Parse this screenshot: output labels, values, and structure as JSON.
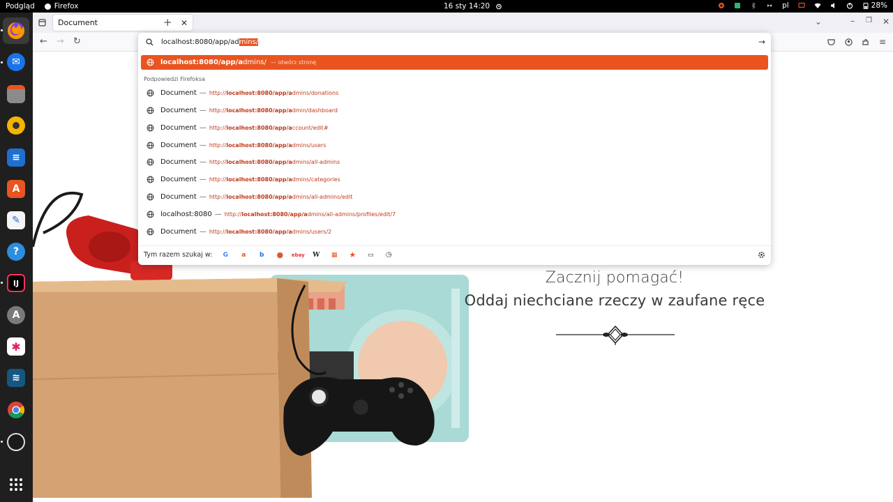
{
  "topbar": {
    "app_label": "Podgląd",
    "firefox_label": "Firefox",
    "datetime": "16 sty  14:20",
    "lang": "pl",
    "battery": "28%"
  },
  "dock": {
    "items": [
      "firefox-icon",
      "thunderbird-icon",
      "files-icon",
      "rhythmbox-icon",
      "writer-icon",
      "app-center-icon",
      "text-editor-icon",
      "help-icon",
      "intellij-icon",
      "software-updater-icon",
      "slack-icon",
      "mysql-workbench-icon",
      "chrome-icon",
      "obs-icon",
      "show-apps-icon"
    ]
  },
  "browser": {
    "tab_title": "Document",
    "url_typed": "localhost:8080/app/ad",
    "url_autofill": "mins/"
  },
  "dropdown": {
    "highlight": {
      "bold": "localhost:8080/app/a",
      "rest": "dmins/",
      "action": "— otwórz stronę"
    },
    "section_header": "Podpowiedzi Firefoksa",
    "suggestions": [
      {
        "title": "Document",
        "sep": "—",
        "url_pre": "http://",
        "url_bold": "localhost:8080/app/a",
        "url_rest": "dmins/donations"
      },
      {
        "title": "Document",
        "sep": "—",
        "url_pre": "http://",
        "url_bold": "localhost:8080/app/a",
        "url_rest": "dmin/dashboard"
      },
      {
        "title": "Document",
        "sep": "—",
        "url_pre": "http://",
        "url_bold": "localhost:8080/app/a",
        "url_rest": "ccount/edit#"
      },
      {
        "title": "Document",
        "sep": "—",
        "url_pre": "http://",
        "url_bold": "localhost:8080/app/a",
        "url_rest": "dmins/users"
      },
      {
        "title": "Document",
        "sep": "—",
        "url_pre": "http://",
        "url_bold": "localhost:8080/app/a",
        "url_rest": "dmins/all-admins"
      },
      {
        "title": "Document",
        "sep": "—",
        "url_pre": "http://",
        "url_bold": "localhost:8080/app/a",
        "url_rest": "dmins/categories"
      },
      {
        "title": "Document",
        "sep": "—",
        "url_pre": "http://",
        "url_bold": "localhost:8080/app/a",
        "url_rest": "dmins/all-admins/edit"
      },
      {
        "title": "localhost:8080",
        "sep": "—",
        "url_pre": "http://",
        "url_bold": "localhost:8080/app/a",
        "url_rest": "dmins/all-admins/profiles/edit/7"
      },
      {
        "title": "Document",
        "sep": "—",
        "url_pre": "http://",
        "url_bold": "localhost:8080/app/a",
        "url_rest": "dmins/users/2"
      }
    ],
    "search_label": "Tym razem szukaj w:",
    "engines": [
      "google-icon",
      "amazon-icon",
      "bing-icon",
      "duckduckgo-icon",
      "ebay-icon",
      "wikipedia-icon",
      "tabs-icon",
      "bookmarks-icon",
      "history-icon"
    ]
  },
  "page": {
    "line1": "Zacznij pomagać!",
    "line2": "Oddaj niechciane rzeczy w zaufane ręce"
  }
}
